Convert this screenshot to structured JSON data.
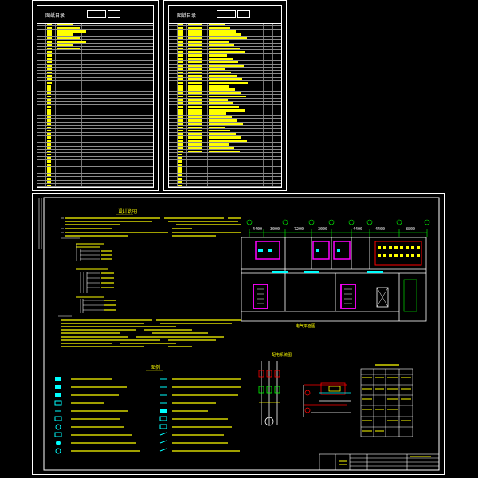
{
  "sheets": {
    "left_title": "图纸目录",
    "right_title": "图纸目录"
  },
  "main": {
    "design_notes_title": "设计说明",
    "legend_title": "图例",
    "plan_caption": "电气平面图",
    "system_caption": "配电系统图",
    "dimensions": [
      "4400",
      "3000",
      "7200",
      "3000",
      "4400",
      "4400",
      "8800"
    ]
  },
  "colors": {
    "yellow": "#ffff00",
    "magenta": "#ff00ff",
    "red": "#ff0000",
    "cyan": "#00ffff",
    "green": "#00ff00",
    "white": "#ffffff"
  }
}
